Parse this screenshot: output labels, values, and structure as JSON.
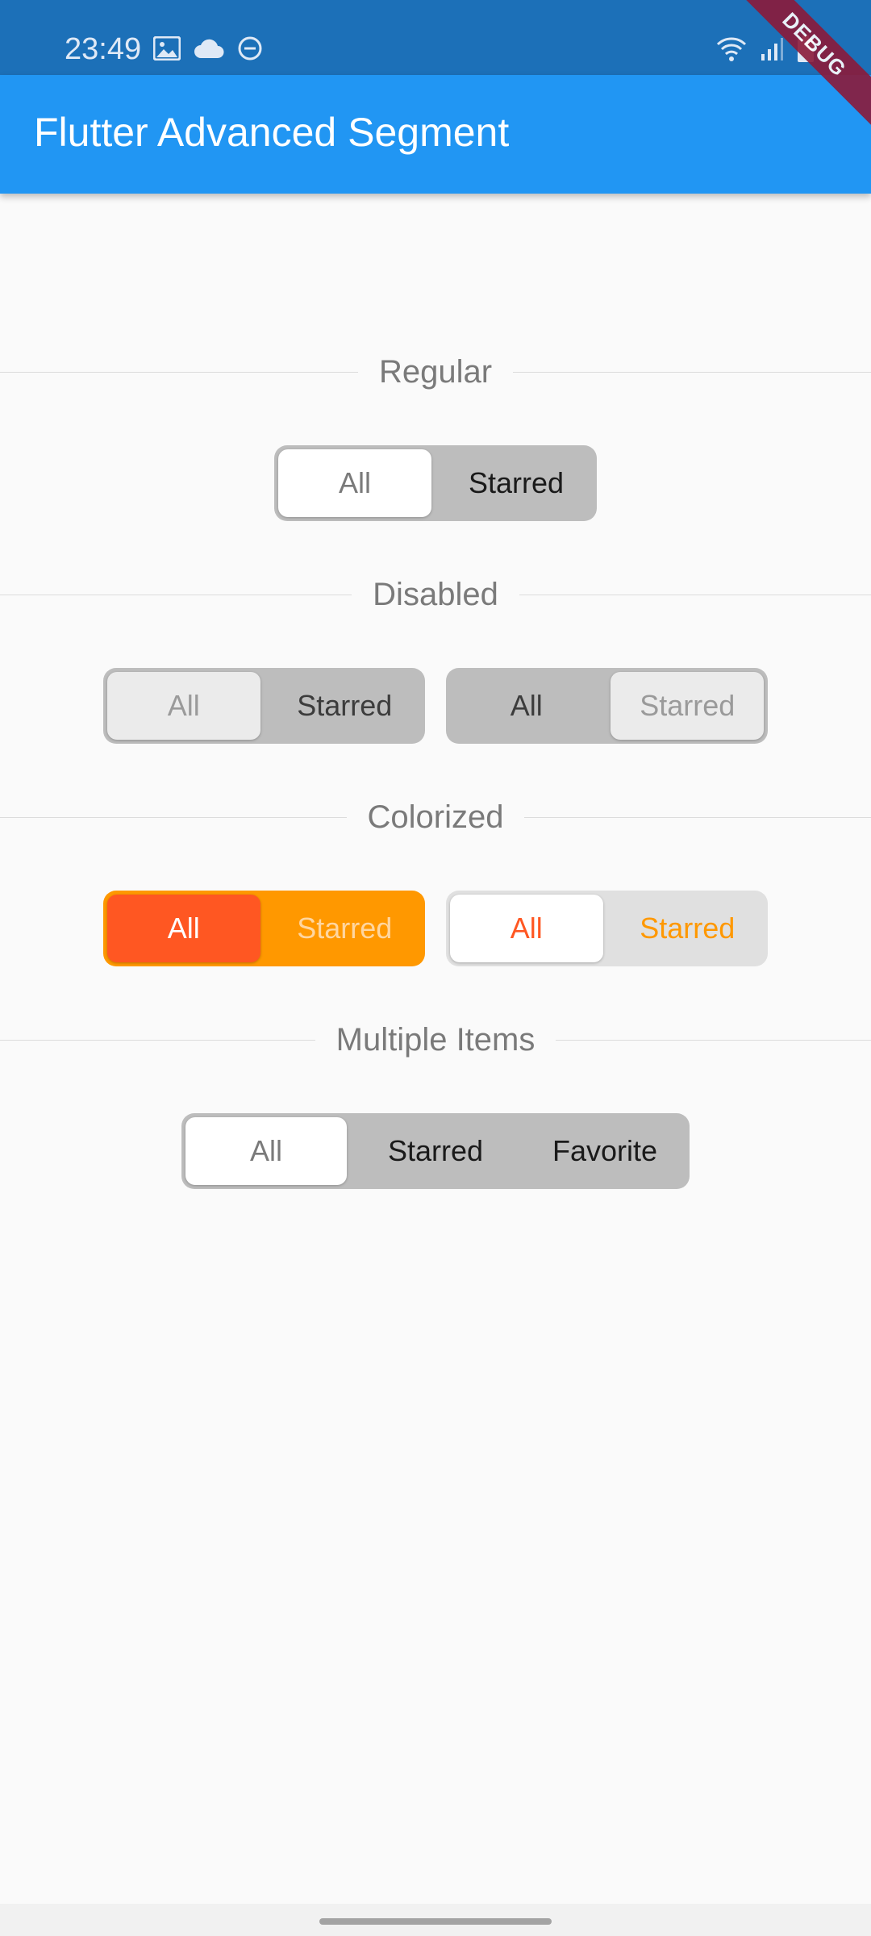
{
  "status_bar": {
    "time": "23:49",
    "left_icons": [
      "image-icon",
      "cloud-icon",
      "do-not-disturb-icon"
    ],
    "right_icons": [
      "wifi-icon",
      "signal-icon",
      "battery-icon"
    ]
  },
  "app_bar": {
    "title": "Flutter Advanced Segment",
    "debug_banner": "DEBUG"
  },
  "sections": {
    "regular": {
      "label": "Regular",
      "segment": {
        "items": [
          "All",
          "Starred"
        ],
        "selected": "All"
      }
    },
    "disabled": {
      "label": "Disabled",
      "segment_a": {
        "items": [
          "All",
          "Starred"
        ],
        "selected": "All"
      },
      "segment_b": {
        "items": [
          "All",
          "Starred"
        ],
        "selected": "Starred"
      }
    },
    "colorized": {
      "label": "Colorized",
      "segment_a": {
        "items": [
          "All",
          "Starred"
        ],
        "selected": "All"
      },
      "segment_b": {
        "items": [
          "All",
          "Starred"
        ],
        "selected": "All"
      }
    },
    "multiple": {
      "label": "Multiple Items",
      "segment": {
        "items": [
          "All",
          "Starred",
          "Favorite"
        ],
        "selected": "All"
      }
    }
  },
  "colors": {
    "status_bar": "#1c70b8",
    "app_bar": "#2196f3",
    "orange_accent": "#ff5722",
    "orange": "#ff9800",
    "segment_bg": "#bdbdbd"
  }
}
